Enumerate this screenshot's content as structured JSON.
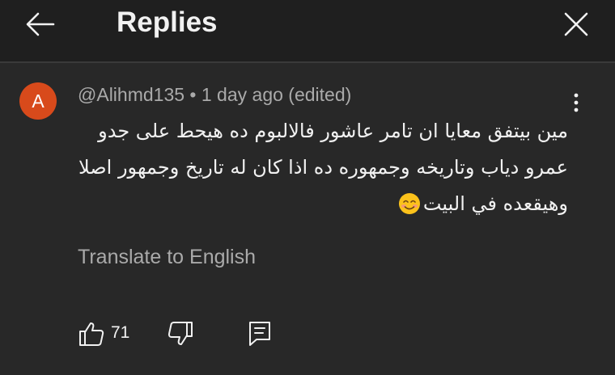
{
  "header": {
    "title": "Replies",
    "back_icon": "arrow-left-icon",
    "close_icon": "close-icon"
  },
  "comment": {
    "avatar_letter": "A",
    "avatar_color": "#d84a1b",
    "author": "@Alihmd135",
    "separator": "•",
    "timestamp": "1 day ago",
    "edited_label": "(edited)",
    "text_lines": [
      "مين بيتفق معايا ان تامر عاشور فالالبوم ده هيحط على جدو",
      "عمرو دياب وتاريخه وجمهوره ده اذا كان له تاريخ وجمهور اصلا",
      "وهيقعده في البيت"
    ],
    "emoji": "smiling-face-emoji",
    "translate_label": "Translate to English",
    "like_count": "71",
    "more_icon": "more-vertical-icon",
    "like_icon": "thumbs-up-icon",
    "dislike_icon": "thumbs-down-icon",
    "reply_icon": "reply-comment-icon"
  }
}
